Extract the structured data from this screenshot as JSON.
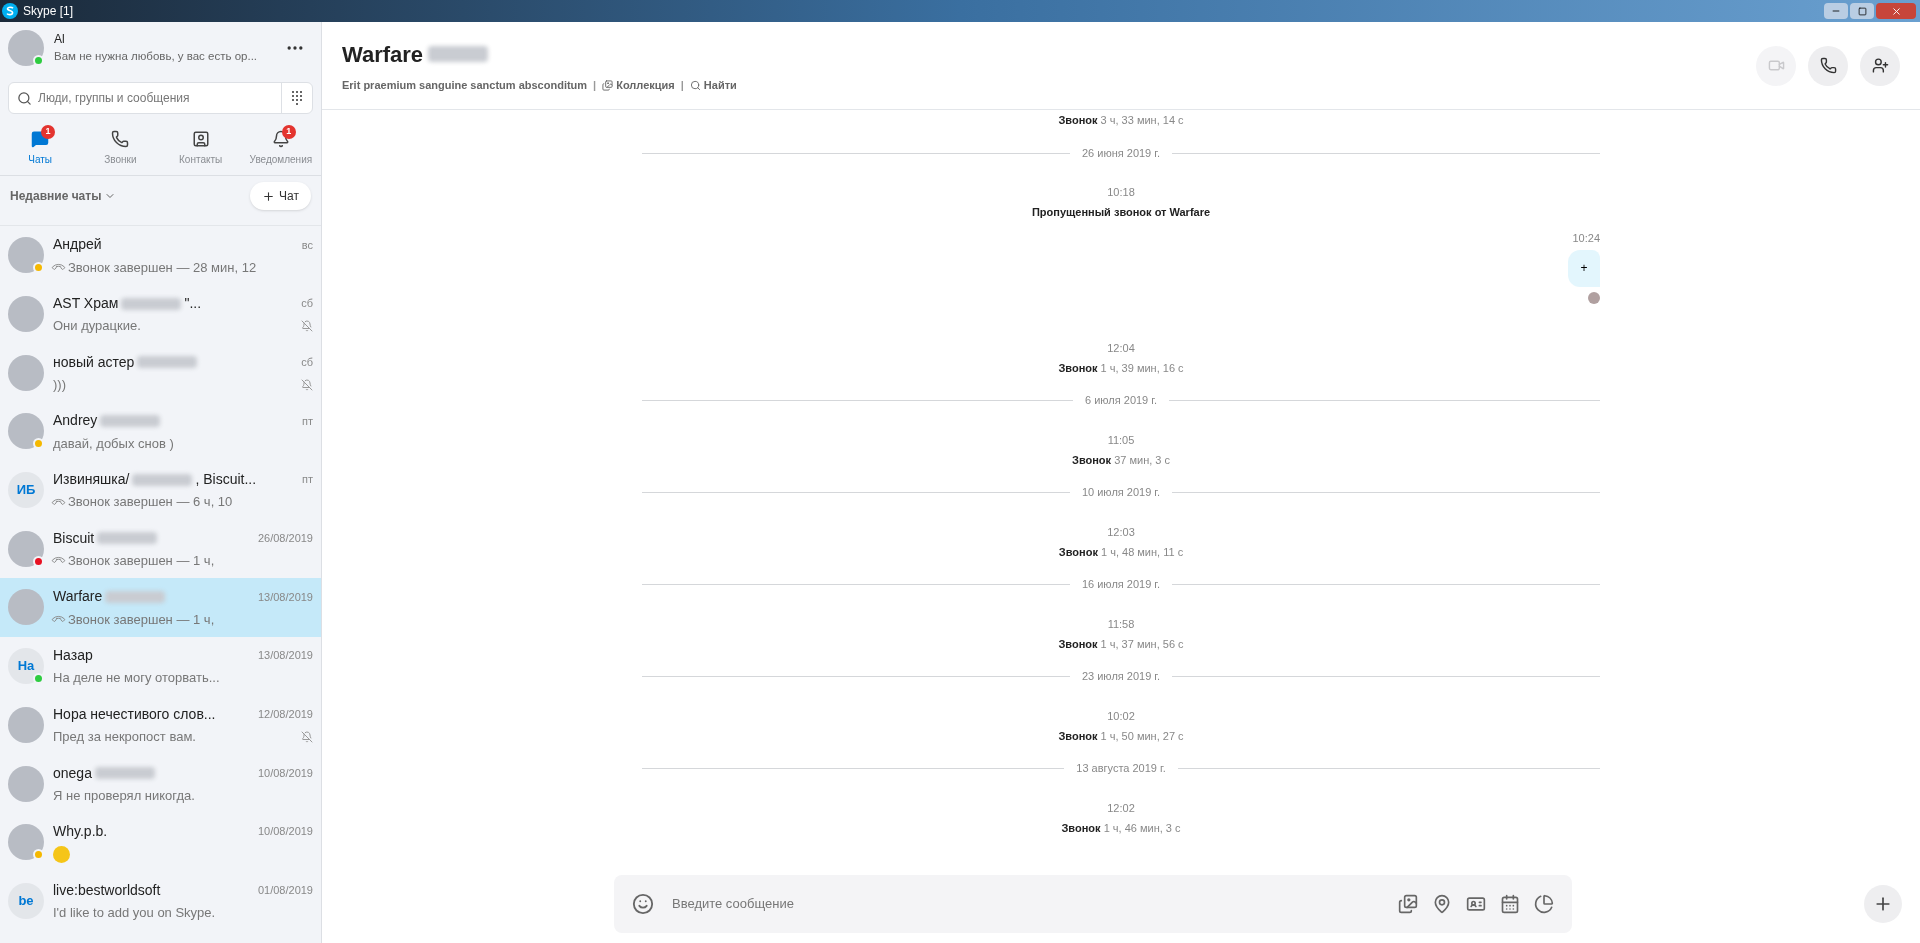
{
  "window": {
    "title": "Skype [1]"
  },
  "profile": {
    "name": "Al",
    "mood": "Вам не нужна любовь, у вас есть ор...",
    "color": "#2ecc40"
  },
  "search": {
    "placeholder": "Люди, группы и сообщения"
  },
  "nav": [
    {
      "label": "Чаты",
      "selected": true,
      "badge": "1",
      "kind": "chats"
    },
    {
      "label": "Звонки",
      "selected": false,
      "kind": "calls"
    },
    {
      "label": "Контакты",
      "selected": false,
      "kind": "contacts"
    },
    {
      "label": "Уведомления",
      "selected": false,
      "badge": "1",
      "kind": "notifications"
    }
  ],
  "recent": {
    "label": "Недавние чаты",
    "new_chat": "Чат"
  },
  "chats": [
    {
      "name": "Андрей",
      "blurred": false,
      "time": "вс",
      "preview": "Звонок завершен — 28 мин, 12",
      "call_ended": true,
      "avatar": {
        "kind": "photo"
      },
      "color": "#f5b800",
      "muted": false,
      "selected": false
    },
    {
      "name": "AST Храм",
      "blurred": true,
      "name_tail": "\"...",
      "time": "сб",
      "preview": "Они дурацкие.",
      "call_ended": false,
      "avatar": {
        "kind": "photo"
      },
      "muted": true,
      "selected": false
    },
    {
      "name": "новый астер",
      "blurred": true,
      "time": "сб",
      "preview": ")))",
      "call_ended": false,
      "avatar": {
        "kind": "photo"
      },
      "muted": true,
      "selected": false
    },
    {
      "name": "Andrey",
      "blurred": true,
      "time": "пт",
      "preview": "давай, добых снов )",
      "call_ended": false,
      "avatar": {
        "kind": "photo"
      },
      "color": "#f5b800",
      "muted": false,
      "selected": false
    },
    {
      "name": "Извиняшка/",
      "blurred": true,
      "name_tail": ", Biscuit...",
      "time": "пт",
      "preview": "Звонок завершен — 6 ч, 10",
      "call_ended": true,
      "avatar": {
        "kind": "initials",
        "initials": "ИБ"
      },
      "muted": false,
      "selected": false
    },
    {
      "name": "Biscuit",
      "blurred": true,
      "time": "26/08/2019",
      "preview": "Звонок завершен — 1 ч,",
      "call_ended": true,
      "avatar": {
        "kind": "photo"
      },
      "color": "#e81123",
      "muted": false,
      "selected": false
    },
    {
      "name": "Warfare",
      "blurred": true,
      "time": "13/08/2019",
      "preview": "Звонок завершен — 1 ч,",
      "call_ended": true,
      "avatar": {
        "kind": "photo"
      },
      "muted": false,
      "selected": true
    },
    {
      "name": "Назар",
      "blurred": false,
      "time": "13/08/2019",
      "preview": "На деле не могу оторвать...",
      "call_ended": false,
      "avatar": {
        "kind": "initials",
        "initials": "На"
      },
      "color": "#2ecc40",
      "muted": false,
      "selected": false
    },
    {
      "name": "Нора нечестивого слов...",
      "blurred": false,
      "time": "12/08/2019",
      "preview": "Пред за некропост вам.",
      "call_ended": false,
      "avatar": {
        "kind": "photo"
      },
      "muted": true,
      "selected": false
    },
    {
      "name": "onega",
      "blurred": true,
      "time": "10/08/2019",
      "preview": "Я не проверял никогда.",
      "call_ended": false,
      "avatar": {
        "kind": "photo"
      },
      "muted": false,
      "selected": false
    },
    {
      "name": "Why.p.b.",
      "blurred": false,
      "time": "10/08/2019",
      "emoji": true,
      "call_ended": false,
      "avatar": {
        "kind": "photo"
      },
      "color": "#f5b800",
      "muted": false,
      "selected": false
    },
    {
      "name": "live:bestworldsoft",
      "blurred": false,
      "time": "01/08/2019",
      "preview": "I'd like to add you on Skype.",
      "call_ended": false,
      "avatar": {
        "kind": "initials",
        "initials": "be"
      },
      "muted": false,
      "selected": false
    }
  ],
  "conversation": {
    "title": "Warfare",
    "title_blurred": true,
    "topic": "Erit praemium sanguine sanctum absconditum",
    "separator": "|",
    "gallery": "Коллекция",
    "separator_2": "|",
    "find": "Найти",
    "messages": [
      {
        "kind": "call",
        "text": "**Звонок** 3 ч, 33 мин, 14 с"
      },
      {
        "kind": "date",
        "text": "26 июня 2019 г."
      },
      {
        "kind": "missed",
        "time": "10:18",
        "text": "Пропущенный звонок от Warfare"
      },
      {
        "kind": "outgoing",
        "time": "10:24",
        "text": "+"
      },
      {
        "kind": "call",
        "time": "12:04",
        "text": "**Звонок** 1 ч, 39 мин, 16 с"
      },
      {
        "kind": "date",
        "text": "6 июля 2019 г."
      },
      {
        "kind": "call",
        "time": "11:05",
        "text": "**Звонок** 37 мин, 3 с"
      },
      {
        "kind": "date",
        "text": "10 июля 2019 г."
      },
      {
        "kind": "call",
        "time": "12:03",
        "text": "**Звонок** 1 ч, 48 мин, 11 с"
      },
      {
        "kind": "date",
        "text": "16 июля 2019 г."
      },
      {
        "kind": "call",
        "time": "11:58",
        "text": "**Звонок** 1 ч, 37 мин, 56 с"
      },
      {
        "kind": "date",
        "text": "23 июля 2019 г."
      },
      {
        "kind": "call",
        "time": "10:02",
        "text": "**Звонок** 1 ч, 50 мин, 27 с"
      },
      {
        "kind": "date",
        "text": "13 августа 2019 г."
      },
      {
        "kind": "call",
        "time": "12:02",
        "text": "**Звонок** 1 ч, 46 мин, 3 с"
      }
    ],
    "composer": {
      "placeholder": "Введите сообщение"
    }
  }
}
